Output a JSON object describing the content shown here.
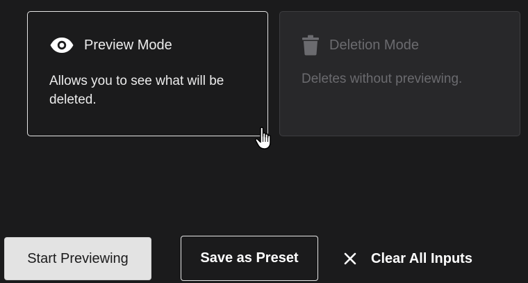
{
  "modes": [
    {
      "title": "Preview Mode",
      "description": "Allows you to see what will be deleted.",
      "icon": "eye-icon",
      "selected": true
    },
    {
      "title": "Deletion Mode",
      "description": "Deletes without previewing.",
      "icon": "trash-icon",
      "selected": false
    }
  ],
  "actions": {
    "start_label": "Start Previewing",
    "save_label": "Save as Preset",
    "clear_label": "Clear All Inputs",
    "clear_icon": "close-icon"
  },
  "colors": {
    "background": "#1b1b1c",
    "selected_border": "#e6e6e6",
    "disabled_card_bg": "#28282a",
    "disabled_text": "#6b6b6f",
    "primary_button_bg": "#e3e3e3"
  }
}
